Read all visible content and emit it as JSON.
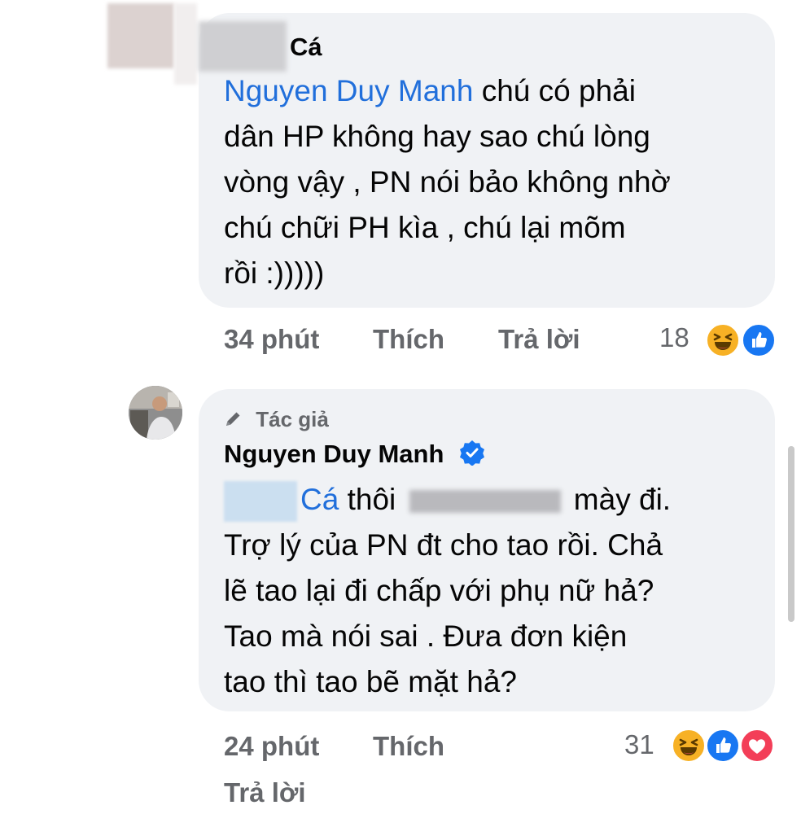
{
  "comment_1": {
    "author_name": "Cá",
    "mention": "Nguyen Duy Manh",
    "lines": [
      " chú có phải",
      "dân HP không hay sao chú lòng",
      "vòng vậy , PN nói bảo không nhờ",
      "chú chữi PH kìa , chú lại mõm",
      "rồi :)))))"
    ],
    "time": "34 phút",
    "like_label": "Thích",
    "reply_label": "Trả lời",
    "reaction_count": "18",
    "reactions": [
      "haha-icon",
      "like-icon"
    ]
  },
  "comment_2": {
    "author_badge": "Tác giả",
    "author_name": "Nguyen Duy Manh",
    "mention": "Cá",
    "line1_prefix": " thôi ",
    "line1_suffix": " mày đi.",
    "lines": [
      "Trợ lý của PN đt cho tao rồi. Chả",
      "lẽ tao lại đi chấp với phụ nữ hả?",
      "Tao mà nói sai . Đưa đơn kiện",
      "tao thì tao bẽ mặt hả?"
    ],
    "time": "24 phút",
    "like_label": "Thích",
    "reply_label": "Trả lời",
    "reaction_count": "31",
    "reactions": [
      "haha-icon",
      "like-icon",
      "love-icon"
    ]
  },
  "colors": {
    "bubble": "#f0f2f5",
    "mention": "#216fdb",
    "secondary_text": "#65676b",
    "like_blue": "#1877f2",
    "love_red": "#f33e58",
    "haha_yellow": "#f7b125"
  }
}
